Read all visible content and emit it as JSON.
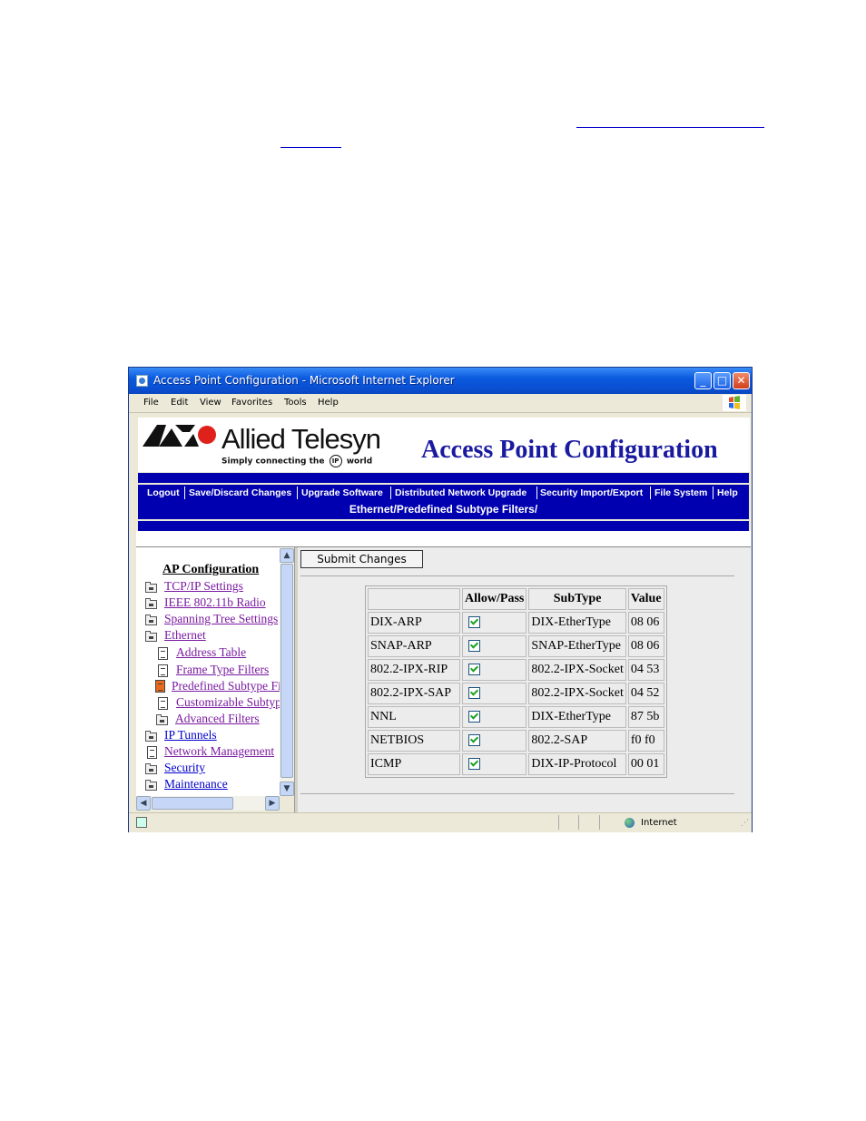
{
  "window": {
    "title": "Access Point Configuration - Microsoft Internet Explorer"
  },
  "menu": [
    "File",
    "Edit",
    "View",
    "Favorites",
    "Tools",
    "Help"
  ],
  "header": {
    "brand": "Allied Telesyn",
    "tagline_pre": "Simply connecting the",
    "tagline_ip": "IP",
    "tagline_post": "world",
    "app_title": "Access Point Configuration"
  },
  "nav": [
    "Logout",
    "Save/Discard Changes",
    "Upgrade Software",
    "Distributed Network Upgrade",
    "Security Import/Export",
    "File System",
    "Help"
  ],
  "breadcrumb": "Ethernet/Predefined Subtype Filters/",
  "sidebar": {
    "heading": "AP Configuration",
    "items": [
      {
        "label": "TCP/IP Settings",
        "icon": "folder-icon"
      },
      {
        "label": "IEEE 802.11b Radio",
        "icon": "folder-icon"
      },
      {
        "label": "Spanning Tree Settings",
        "icon": "folder-icon"
      },
      {
        "label": "Ethernet",
        "icon": "folder-open-icon"
      },
      {
        "label": "Address Table",
        "icon": "document-icon"
      },
      {
        "label": "Frame Type Filters",
        "icon": "document-icon"
      },
      {
        "label": "Predefined Subtype Filters",
        "icon": "document-icon"
      },
      {
        "label": "Customizable Subtype Filters",
        "icon": "document-icon"
      },
      {
        "label": "Advanced Filters",
        "icon": "folder-icon"
      },
      {
        "label": "IP Tunnels",
        "icon": "folder-icon"
      },
      {
        "label": "Network Management",
        "icon": "document-icon"
      },
      {
        "label": "Security",
        "icon": "folder-icon"
      },
      {
        "label": "Maintenance",
        "icon": "folder-icon"
      }
    ]
  },
  "main": {
    "submit_label": "Submit Changes",
    "columns": [
      "",
      "Allow/Pass",
      "SubType",
      "Value"
    ],
    "rows": [
      {
        "name": "DIX-ARP",
        "allow": true,
        "subtype": "DIX-EtherType",
        "value": "08 06"
      },
      {
        "name": "SNAP-ARP",
        "allow": true,
        "subtype": "SNAP-EtherType",
        "value": "08 06"
      },
      {
        "name": "802.2-IPX-RIP",
        "allow": true,
        "subtype": "802.2-IPX-Socket",
        "value": "04 53"
      },
      {
        "name": "802.2-IPX-SAP",
        "allow": true,
        "subtype": "802.2-IPX-Socket",
        "value": "04 52"
      },
      {
        "name": "NNL",
        "allow": true,
        "subtype": "DIX-EtherType",
        "value": "87 5b"
      },
      {
        "name": "NETBIOS",
        "allow": true,
        "subtype": "802.2-SAP",
        "value": "f0 f0"
      },
      {
        "name": "ICMP",
        "allow": true,
        "subtype": "DIX-IP-Protocol",
        "value": "00 01"
      }
    ]
  },
  "status": {
    "zone": "Internet"
  },
  "colors": {
    "nav_bar": "#0000b0",
    "link_visited": "#7a1aa0",
    "link": "#0000cc",
    "title_blue": "#1a1aa0"
  }
}
